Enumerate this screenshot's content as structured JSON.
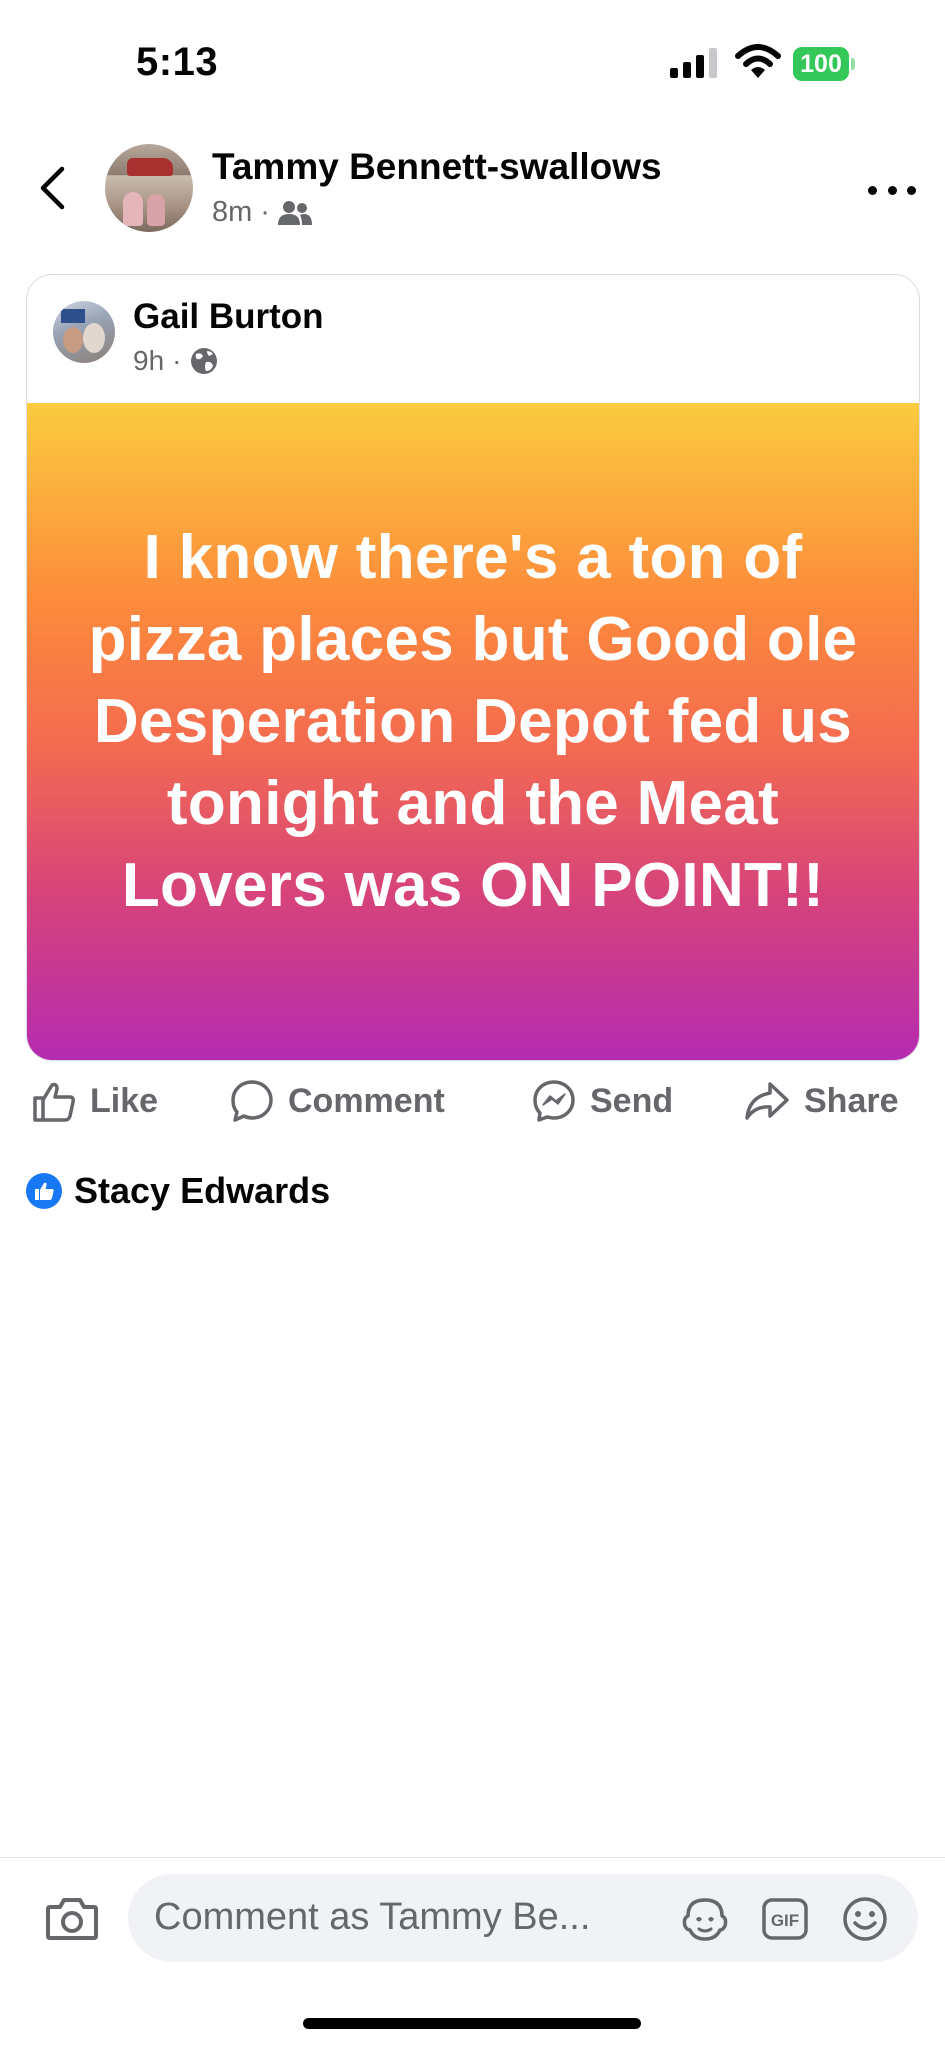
{
  "status_bar": {
    "time": "5:13",
    "battery_level": "100"
  },
  "header": {
    "author_name": "Tammy Bennett-swallows",
    "timestamp": "8m",
    "separator": "·",
    "audience_icon": "friends-icon"
  },
  "shared_post": {
    "author_name": "Gail Burton",
    "timestamp": "9h",
    "separator": "·",
    "audience_icon": "globe-icon",
    "text": "I know there's a ton of pizza places but Good ole Desperation Depot fed us tonight and the Meat Lovers was ON POINT!!",
    "background_gradient": [
      "#fbcb3f",
      "#fd8b3b",
      "#f36b50",
      "#d6437b",
      "#b52bb0"
    ]
  },
  "actions": {
    "like_label": "Like",
    "comment_label": "Comment",
    "send_label": "Send",
    "share_label": "Share"
  },
  "reactions": {
    "reactor_name": "Stacy Edwards",
    "reaction_icon": "like-icon"
  },
  "comment_bar": {
    "placeholder": "Comment as Tammy Be..."
  },
  "colors": {
    "accent": "#1877f2",
    "battery": "#34c759",
    "secondary_text": "#65676b"
  }
}
